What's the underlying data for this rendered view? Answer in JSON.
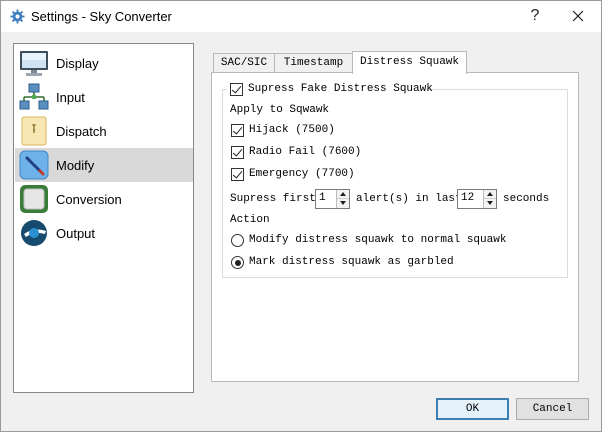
{
  "window": {
    "title": "Settings - Sky Converter",
    "help_glyph": "?"
  },
  "sidebar": {
    "items": [
      {
        "label": "Display",
        "icon": "monitor-icon"
      },
      {
        "label": "Input",
        "icon": "network-icon"
      },
      {
        "label": "Dispatch",
        "icon": "document-icon"
      },
      {
        "label": "Modify",
        "icon": "pen-icon",
        "selected": true
      },
      {
        "label": "Conversion",
        "icon": "square-icon"
      },
      {
        "label": "Output",
        "icon": "output-logo-icon"
      }
    ]
  },
  "tabs": [
    {
      "label": "SAC/SIC"
    },
    {
      "label": "Timestamp"
    },
    {
      "label": "Distress Squawk",
      "active": true
    }
  ],
  "distress": {
    "supress_fake_label": "Supress Fake Distress Squawk",
    "supress_fake_checked": true,
    "apply_heading": "Apply to Sqwawk",
    "codes": [
      {
        "label": "Hijack (7500)",
        "checked": true
      },
      {
        "label": "Radio Fail (7600)",
        "checked": true
      },
      {
        "label": "Emergency (7700)",
        "checked": true
      }
    ],
    "supress_first_label": "Supress first",
    "first_value": "1",
    "alerts_in_last_label": "alert(s) in last",
    "last_value": "12",
    "seconds_label": "seconds",
    "action_heading": "Action",
    "actions": [
      {
        "label": "Modify distress squawk to normal squawk",
        "selected": false
      },
      {
        "label": "Mark distress squawk as garbled",
        "selected": true
      }
    ]
  },
  "buttons": {
    "ok": "OK",
    "cancel": "Cancel"
  },
  "colors": {
    "selection": "#d9d9d9",
    "default_button_border": "#3c7fb1",
    "window_bg": "#f0f0f0"
  }
}
